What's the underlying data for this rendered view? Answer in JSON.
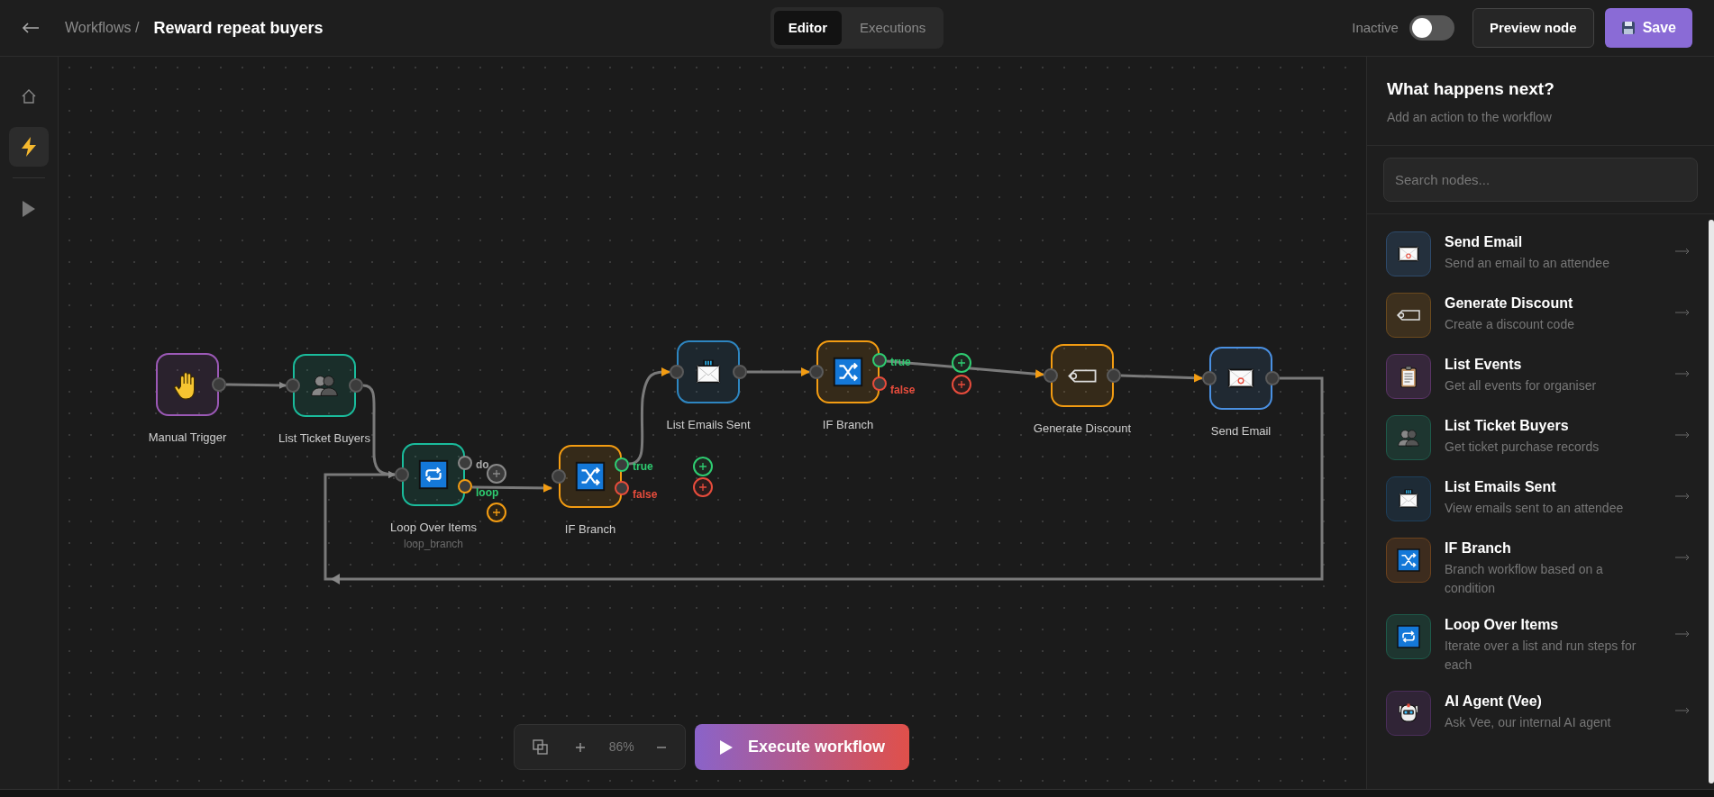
{
  "header": {
    "breadcrumb": "Workflows /",
    "title": "Reward repeat buyers"
  },
  "view_tabs": [
    {
      "label": "Editor",
      "selected": true
    },
    {
      "label": "Executions",
      "selected": false
    }
  ],
  "active_toggle": {
    "label": "Inactive",
    "on": false
  },
  "buttons": [
    {
      "label": "Preview node",
      "kind": "secondary"
    },
    {
      "label": "Save",
      "kind": "primary"
    }
  ],
  "rail": [
    {
      "kind": "home",
      "selected": false
    },
    {
      "kind": "bolt",
      "selected": true
    },
    {
      "kind": "play",
      "selected": false
    }
  ],
  "nodes": [
    {
      "label": "Manual Trigger",
      "kind": "trigger",
      "color": "#9b59b6"
    },
    {
      "label": "List Ticket Buyers",
      "kind": "buyers",
      "color": "#1abc9c"
    },
    {
      "label": "Loop Over Items",
      "sublabel": "loop_branch",
      "kind": "loop",
      "color": "#1abc9c",
      "ports": [
        {
          "label": "do",
          "kind": "done"
        },
        {
          "label": "loop",
          "kind": "loop"
        }
      ]
    },
    {
      "label": "IF Branch",
      "kind": "branch",
      "color": "#f39c12",
      "ports": [
        {
          "label": "true",
          "kind": "true"
        },
        {
          "label": "false",
          "kind": "false"
        }
      ]
    },
    {
      "label": "List Emails Sent",
      "kind": "emails_list",
      "color": "#2e86c1"
    },
    {
      "label": "IF Branch",
      "kind": "branch",
      "color": "#f39c12",
      "ports": [
        {
          "label": "true",
          "kind": "true"
        },
        {
          "label": "false",
          "kind": "false"
        }
      ]
    },
    {
      "label": "Generate Discount",
      "kind": "discount",
      "color": "#f39c12"
    },
    {
      "label": "Send Email",
      "kind": "email",
      "color": "#4a90e2"
    }
  ],
  "zoom_controls": {
    "percent": "86%"
  },
  "execute_button": {
    "label": "Execute workflow"
  },
  "panel": {
    "title": "What happens next?",
    "subtitle": "Add an action to the workflow",
    "search": {
      "placeholder": "Search nodes..."
    },
    "items": [
      {
        "title": "Send Email",
        "description": "Send an email to an attendee",
        "kind": "email",
        "color": "#2e4a6b"
      },
      {
        "title": "Generate Discount",
        "description": "Create a discount code",
        "kind": "discount",
        "color": "#6b4a1e"
      },
      {
        "title": "List Events",
        "description": "Get all events for organiser",
        "kind": "events",
        "color": "#5a3466"
      },
      {
        "title": "List Ticket Buyers",
        "description": "Get ticket purchase records",
        "kind": "buyers",
        "color": "#1e5a4a"
      },
      {
        "title": "List Emails Sent",
        "description": "View emails sent to an attendee",
        "kind": "emails_list",
        "color": "#1e3f5a"
      },
      {
        "title": "IF Branch",
        "description": "Branch workflow based on a condition",
        "kind": "branch",
        "color": "#6b421e"
      },
      {
        "title": "Loop Over Items",
        "description": "Iterate over a list and run steps for each",
        "kind": "loop",
        "color": "#1e5a4a"
      },
      {
        "title": "AI Agent (Vee)",
        "description": "Ask Vee, our internal AI agent",
        "kind": "agent",
        "color": "#4a2e5a"
      }
    ]
  }
}
